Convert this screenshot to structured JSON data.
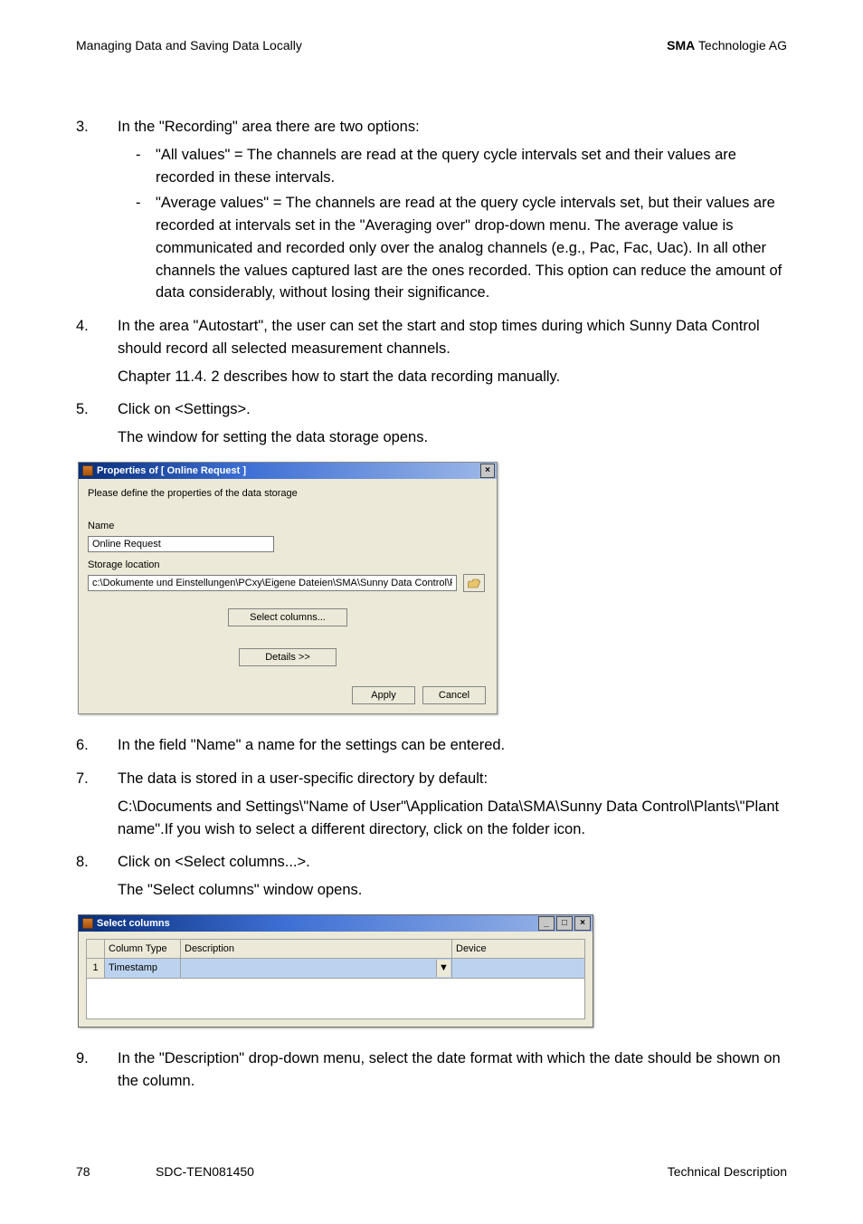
{
  "header": {
    "left": "Managing Data and Saving Data Locally",
    "right_bold": "SMA",
    "right_rest": " Technologie AG"
  },
  "footer": {
    "page": "78",
    "doc": "SDC-TEN081450",
    "right": "Technical Description"
  },
  "steps": {
    "s3": {
      "num": "3.",
      "intro": "In the \"Recording\" area there are two options:",
      "dash": "-",
      "bullet1": "\"All values\" = The channels are read at the query cycle intervals set and their values are recorded in these intervals.",
      "bullet2": "\"Average values\" = The channels are read at the query cycle intervals set, but their values are recorded at intervals set in the \"Averaging over\" drop-down menu. The average value is communicated and recorded only over the analog channels (e.g., Pac, Fac, Uac). In all other channels the values captured last are the ones recorded. This option can reduce the amount of data considerably, without losing their significance."
    },
    "s4": {
      "num": "4.",
      "p1": "In the area \"Autostart\", the user can set the start and stop times during which Sunny Data Control should record all selected measurement channels.",
      "p2": "Chapter 11.4. 2 describes how to start the data recording manually."
    },
    "s5": {
      "num": "5.",
      "p1": "Click on <Settings>.",
      "p2": "The window for setting the data storage  opens."
    },
    "s6": {
      "num": "6.",
      "p1": "In the field \"Name\" a name for the settings can be entered."
    },
    "s7": {
      "num": "7.",
      "p1": "The data is stored in a user-specific directory by default:",
      "p2": "C:\\Documents and Settings\\\"Name of User\"\\Application Data\\SMA\\Sunny Data Control\\Plants\\\"Plant name\".If you wish to select a different directory, click on the folder icon."
    },
    "s8": {
      "num": "8.",
      "p1": "Click on <Select columns...>.",
      "p2": "The \"Select columns\" window opens."
    },
    "s9": {
      "num": "9.",
      "p1": "In the \"Description\" drop-down menu, select the date format with which the date should be shown on the column."
    }
  },
  "dialog1": {
    "title": "Properties of [ Online Request ]",
    "close_x": "×",
    "instruction": "Please define the properties of the data storage",
    "name_label": "Name",
    "name_value": "Online Request",
    "storage_label": "Storage location",
    "storage_value": "c:\\Dokumente und Einstellungen\\PCxy\\Eigene Dateien\\SMA\\Sunny Data Control\\Plants\\USB-SI\\",
    "select_columns": "Select columns...",
    "details": "Details  >>",
    "apply": "Apply",
    "cancel": "Cancel"
  },
  "dialog2": {
    "title": "Select columns",
    "min": "_",
    "max": "□",
    "close": "×",
    "cols": {
      "blank": "",
      "col_type": "Column Type",
      "description": "Description",
      "device": "Device"
    },
    "row": {
      "idx": "1",
      "col_type": "Timestamp",
      "description": "",
      "device": ""
    },
    "dd": "▼"
  }
}
